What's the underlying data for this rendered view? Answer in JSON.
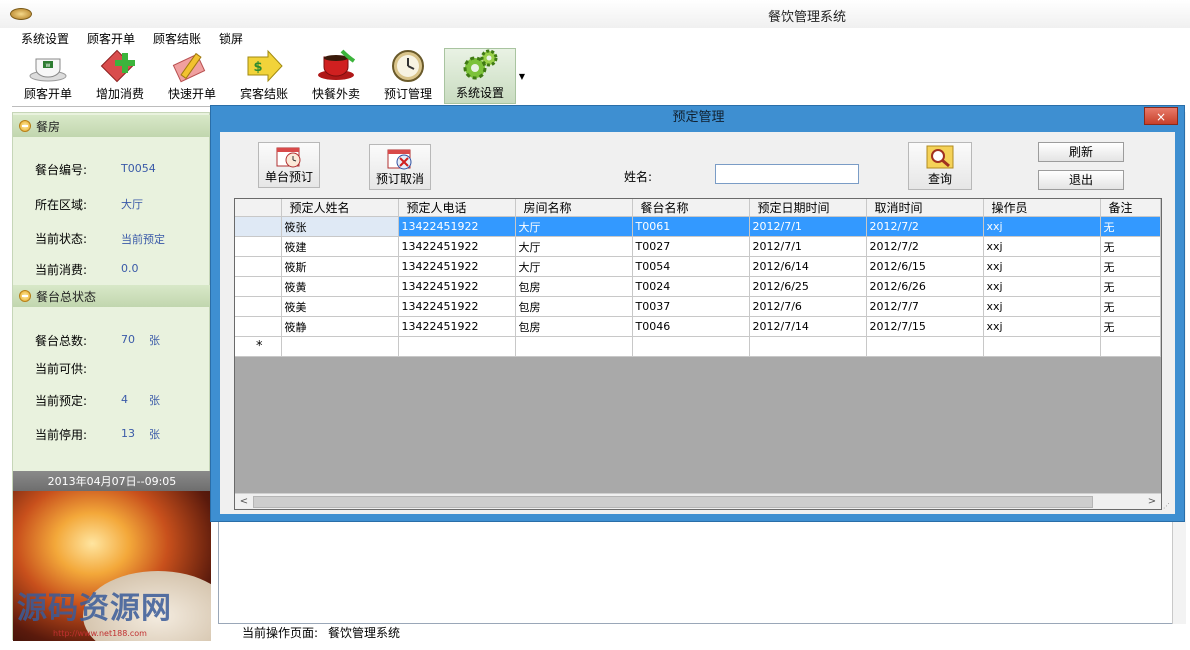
{
  "window": {
    "title": "餐饮管理系统"
  },
  "menu": [
    "系统设置",
    "顾客开单",
    "顾客结账",
    "锁屏"
  ],
  "toolbar": [
    {
      "label": "顾客开单",
      "icon": "teacup-icon"
    },
    {
      "label": "增加消费",
      "icon": "add-plus-icon"
    },
    {
      "label": "快速开单",
      "icon": "pencil-icon"
    },
    {
      "label": "宾客结账",
      "icon": "money-arrow-icon"
    },
    {
      "label": "快餐外卖",
      "icon": "coffee-cup-icon"
    },
    {
      "label": "预订管理",
      "icon": "clock-icon"
    },
    {
      "label": "系统设置",
      "icon": "gears-icon"
    }
  ],
  "left_panel": {
    "room_section": {
      "title": "餐房",
      "rows": [
        {
          "label": "餐台编号:",
          "value": "T0054"
        },
        {
          "label": "所在区域:",
          "value": "大厅"
        },
        {
          "label": "当前状态:",
          "value": "当前预定"
        },
        {
          "label": "当前消费:",
          "value": "0.0"
        }
      ]
    },
    "status_section": {
      "title": "餐台总状态",
      "rows": [
        {
          "label": "餐台总数:",
          "value": "70",
          "unit": "张"
        },
        {
          "label": "当前可供:",
          "value": "",
          "unit": ""
        },
        {
          "label": "当前预定:",
          "value": "4",
          "unit": "张"
        },
        {
          "label": "当前停用:",
          "value": "13",
          "unit": "张"
        }
      ]
    },
    "datetime": "2013年04月07日--09:05",
    "watermark": "源码资源网",
    "watermark_url": "http://www.net188.com"
  },
  "status_bar": {
    "label": "当前操作页面:",
    "value": "餐饮管理系统"
  },
  "dialog": {
    "title": "预定管理",
    "close": "×",
    "buttons": {
      "single_booking": "单台预订",
      "cancel_booking": "预订取消",
      "query": "查询",
      "refresh": "刷新",
      "exit": "退出"
    },
    "name_label": "姓名:",
    "name_value": "",
    "columns": [
      "预定人姓名",
      "预定人电话",
      "房间名称",
      "餐台名称",
      "预定日期时间",
      "取消时间",
      "操作员",
      "备注"
    ],
    "rows": [
      [
        "筱张",
        "13422451922",
        "大厅",
        "T0061",
        "2012/7/1",
        "2012/7/2",
        "xxj",
        "无"
      ],
      [
        "筱建",
        "13422451922",
        "大厅",
        "T0027",
        "2012/7/1",
        "2012/7/2",
        "xxj",
        "无"
      ],
      [
        "筱斯",
        "13422451922",
        "大厅",
        "T0054",
        "2012/6/14",
        "2012/6/15",
        "xxj",
        "无"
      ],
      [
        "筱黄",
        "13422451922",
        "包房",
        "T0024",
        "2012/6/25",
        "2012/6/26",
        "xxj",
        "无"
      ],
      [
        "筱美",
        "13422451922",
        "包房",
        "T0037",
        "2012/7/6",
        "2012/7/7",
        "xxj",
        "无"
      ],
      [
        "筱静",
        "13422451922",
        "包房",
        "T0046",
        "2012/7/14",
        "2012/7/15",
        "xxj",
        "无"
      ]
    ],
    "new_row_marker": "*",
    "scroll_left": "<",
    "scroll_right": ">"
  },
  "colors": {
    "dialog_frame": "#3e8fd1",
    "selection": "#3399ff",
    "panel_bg": "#e9f2de",
    "value_text": "#3a5aa8"
  }
}
